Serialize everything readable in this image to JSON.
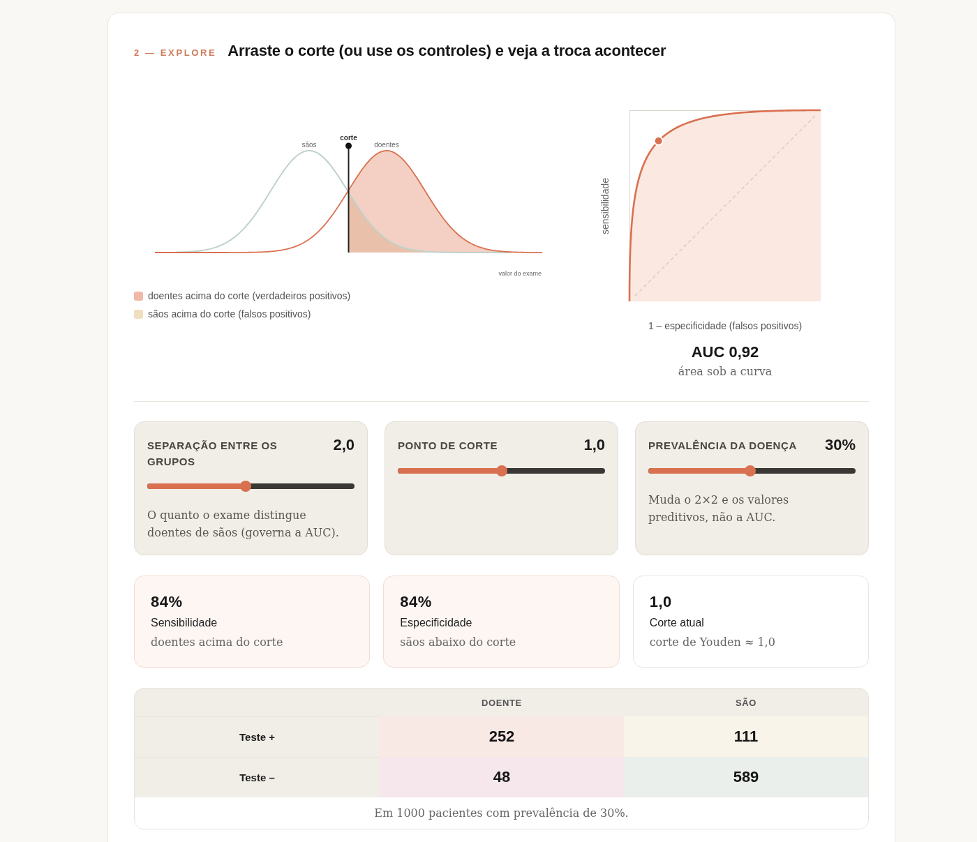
{
  "header": {
    "eyebrow": "2 — EXPLORE",
    "title": "Arraste o corte (ou use os controles) e veja a troca acontecer"
  },
  "distribution_chart": {
    "healthy_label": "sãos",
    "cutoff_label": "corte",
    "sick_label": "doentes",
    "xlabel": "valor do exame"
  },
  "legend": [
    {
      "label": "doentes acima do corte (verdadeiros positivos)",
      "color": "#efb8a7"
    },
    {
      "label": "sãos acima do corte (falsos positivos)",
      "color": "#efdfc0"
    }
  ],
  "roc_chart": {
    "ylabel": "sensibilidade",
    "xlabel": "1 – especificidade (falsos positivos)"
  },
  "auc": {
    "value": "AUC 0,92",
    "caption": "área sob a curva"
  },
  "sliders": [
    {
      "label": "SEPARAÇÃO ENTRE OS GRUPOS",
      "value": "2,0",
      "level": 0.475,
      "description": "O quanto o exame distingue doentes de sãos (governa a AUC)."
    },
    {
      "label": "PONTO DE CORTE",
      "value": "1,0",
      "level": 0.5
    },
    {
      "label": "PREVALÊNCIA DA DOENÇA",
      "value": "30%",
      "level": 0.49,
      "description": "Muda o 2×2 e os valores preditivos, não a AUC."
    }
  ],
  "stats": [
    {
      "value": "84%",
      "label": "Sensibilidade",
      "caption": "doentes acima do corte",
      "highlighted": true
    },
    {
      "value": "84%",
      "label": "Especificidade",
      "caption": "sãos abaixo do corte",
      "highlighted": true
    },
    {
      "value": "1,0",
      "label": "Corte atual",
      "caption": "corte de Youden ≈ 1,0",
      "highlighted": false
    }
  ],
  "table": {
    "columns": [
      "DOENTE",
      "SÃO"
    ],
    "rows": [
      {
        "label": "Teste +",
        "cells": [
          {
            "value": "252",
            "color": "#f9e9e5"
          },
          {
            "value": "111",
            "color": "#f8f4e9"
          }
        ]
      },
      {
        "label": "Teste –",
        "cells": [
          {
            "value": "48",
            "color": "#f6e7ec"
          },
          {
            "value": "589",
            "color": "#eaefec"
          }
        ]
      }
    ],
    "footnote": "Em 1000 pacientes com prevalência de 30%."
  }
}
